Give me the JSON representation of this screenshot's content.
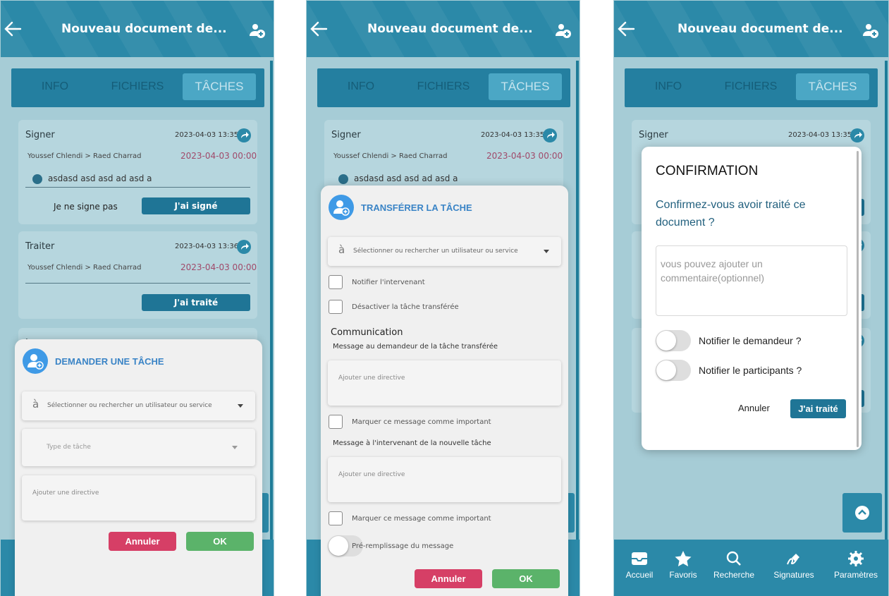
{
  "header": {
    "title": "Nouveau document de..."
  },
  "tabs": [
    "INFO",
    "FICHIERS",
    "TÂCHES"
  ],
  "cards": [
    {
      "title": "Signer",
      "date": "2023-04-03 13:35",
      "from": "Youssef Chlendi",
      "to": "Raed Charrad",
      "due": "2023-04-03 00:00",
      "comment": "asdasd asd asd ad asd a",
      "reject_label": "Je ne signe pas",
      "ok_label": "J'ai signé"
    },
    {
      "title": "Traiter",
      "date": "2023-04-03 13:36",
      "from": "Youssef Chlendi",
      "to": "Raed Charrad",
      "due": "2023-04-03 00:00",
      "ok_label": "J'ai traité"
    },
    {
      "title": "L"
    }
  ],
  "demander": {
    "title": "DEMANDER UNE TÂCHE",
    "to_prefix": "à",
    "user_placeholder": "Sélectionner ou rechercher un utilisateur ou service",
    "type_placeholder": "Type de tâche",
    "directive_placeholder": "Ajouter une directive",
    "cancel_label": "Annuler",
    "ok_label": "OK"
  },
  "transferer": {
    "title": "TRANSFÉRER LA TÂCHE",
    "to_prefix": "à",
    "user_placeholder": "Sélectionner ou rechercher un utilisateur ou service",
    "notify_label": "Notifier l'intervenant",
    "disable_label": "Désactiver la tâche transférée",
    "section_title": "Communication",
    "msg_requester_label": "Message au demandeur de la tâche transférée",
    "directive_placeholder": "Ajouter une directive",
    "important_label": "Marquer ce message comme important",
    "msg_new_label": "Message à l'intervenant de la nouvelle tâche",
    "prefill_label": "Pré-remplissage du message",
    "cancel_label": "Annuler",
    "ok_label": "OK"
  },
  "confirmation": {
    "title": "CONFIRMATION",
    "question": "Confirmez-vous avoir traité ce document ?",
    "comment_placeholder": "vous pouvez ajouter un commentaire(optionnel)",
    "notify_requester": "Notifier le demandeur ?",
    "notify_participants": "Notifier le participants ?",
    "cancel_label": "Annuler",
    "ok_label": "J'ai traité"
  },
  "bottom_nav": [
    {
      "label": "Accueil",
      "icon": "inbox-icon"
    },
    {
      "label": "Favoris",
      "icon": "star-icon"
    },
    {
      "label": "Recherche",
      "icon": "search-icon"
    },
    {
      "label": "Signatures",
      "icon": "signature-icon"
    },
    {
      "label": "Paramètres",
      "icon": "gear-icon"
    }
  ],
  "colors": {
    "header": "#2b89a8",
    "accent_blue": "#3a84c6",
    "cancel_red": "#d63f66",
    "ok_green": "#5bb36a",
    "action_button": "#1f7596"
  }
}
